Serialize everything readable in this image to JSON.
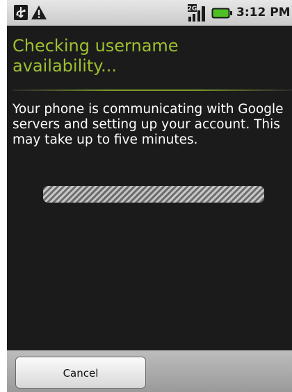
{
  "status_bar": {
    "time": "3:12 PM",
    "icons": [
      "usb-icon",
      "warning-icon",
      "signal-icon",
      "battery-icon"
    ],
    "network_label": "2G"
  },
  "dialog": {
    "title": "Checking username availability...",
    "message": "Your phone is communicating with Google servers and setting up your account. This may take up to five minutes.",
    "progress": {
      "type": "indeterminate",
      "level": 1.0
    }
  },
  "buttons": {
    "cancel_label": "Cancel"
  },
  "colors": {
    "title": "#9ec031",
    "background": "#1b1b1b",
    "message": "#ffffff",
    "status_bar": "#d6d6d6",
    "battery": "#4fbf26"
  }
}
